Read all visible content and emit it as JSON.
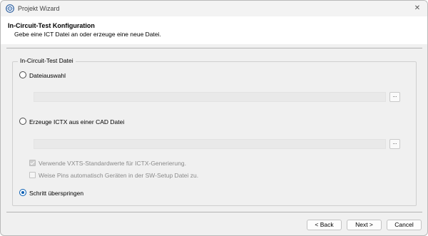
{
  "window": {
    "title": "Projekt Wizard",
    "close_glyph": "✕"
  },
  "header": {
    "title": "In-Circuit-Test Konfiguration",
    "subtitle": "Gebe eine ICT Datei an oder erzeuge eine neue Datei."
  },
  "group": {
    "legend": "In-Circuit-Test Datei",
    "options": [
      {
        "label": "Dateiauswahl",
        "checked": false
      },
      {
        "label": "Erzeuge ICTX aus einer CAD Datei",
        "checked": false
      },
      {
        "label": "Schritt überspringen",
        "checked": true
      }
    ],
    "file_select": {
      "value": "",
      "browse_label": "..."
    },
    "cad_file": {
      "value": "",
      "browse_label": "..."
    },
    "checkboxes": [
      {
        "label": "Verwende VXTS-Standardwerte für ICTX-Generierung.",
        "checked": true,
        "enabled": false
      },
      {
        "label": "Weise Pins automatisch Geräten in der SW-Setup Datei zu.",
        "checked": false,
        "enabled": false
      }
    ]
  },
  "footer": {
    "back_label": "< Back",
    "next_label": "Next >",
    "cancel_label": "Cancel"
  },
  "colors": {
    "accent": "#0a5fb4"
  }
}
